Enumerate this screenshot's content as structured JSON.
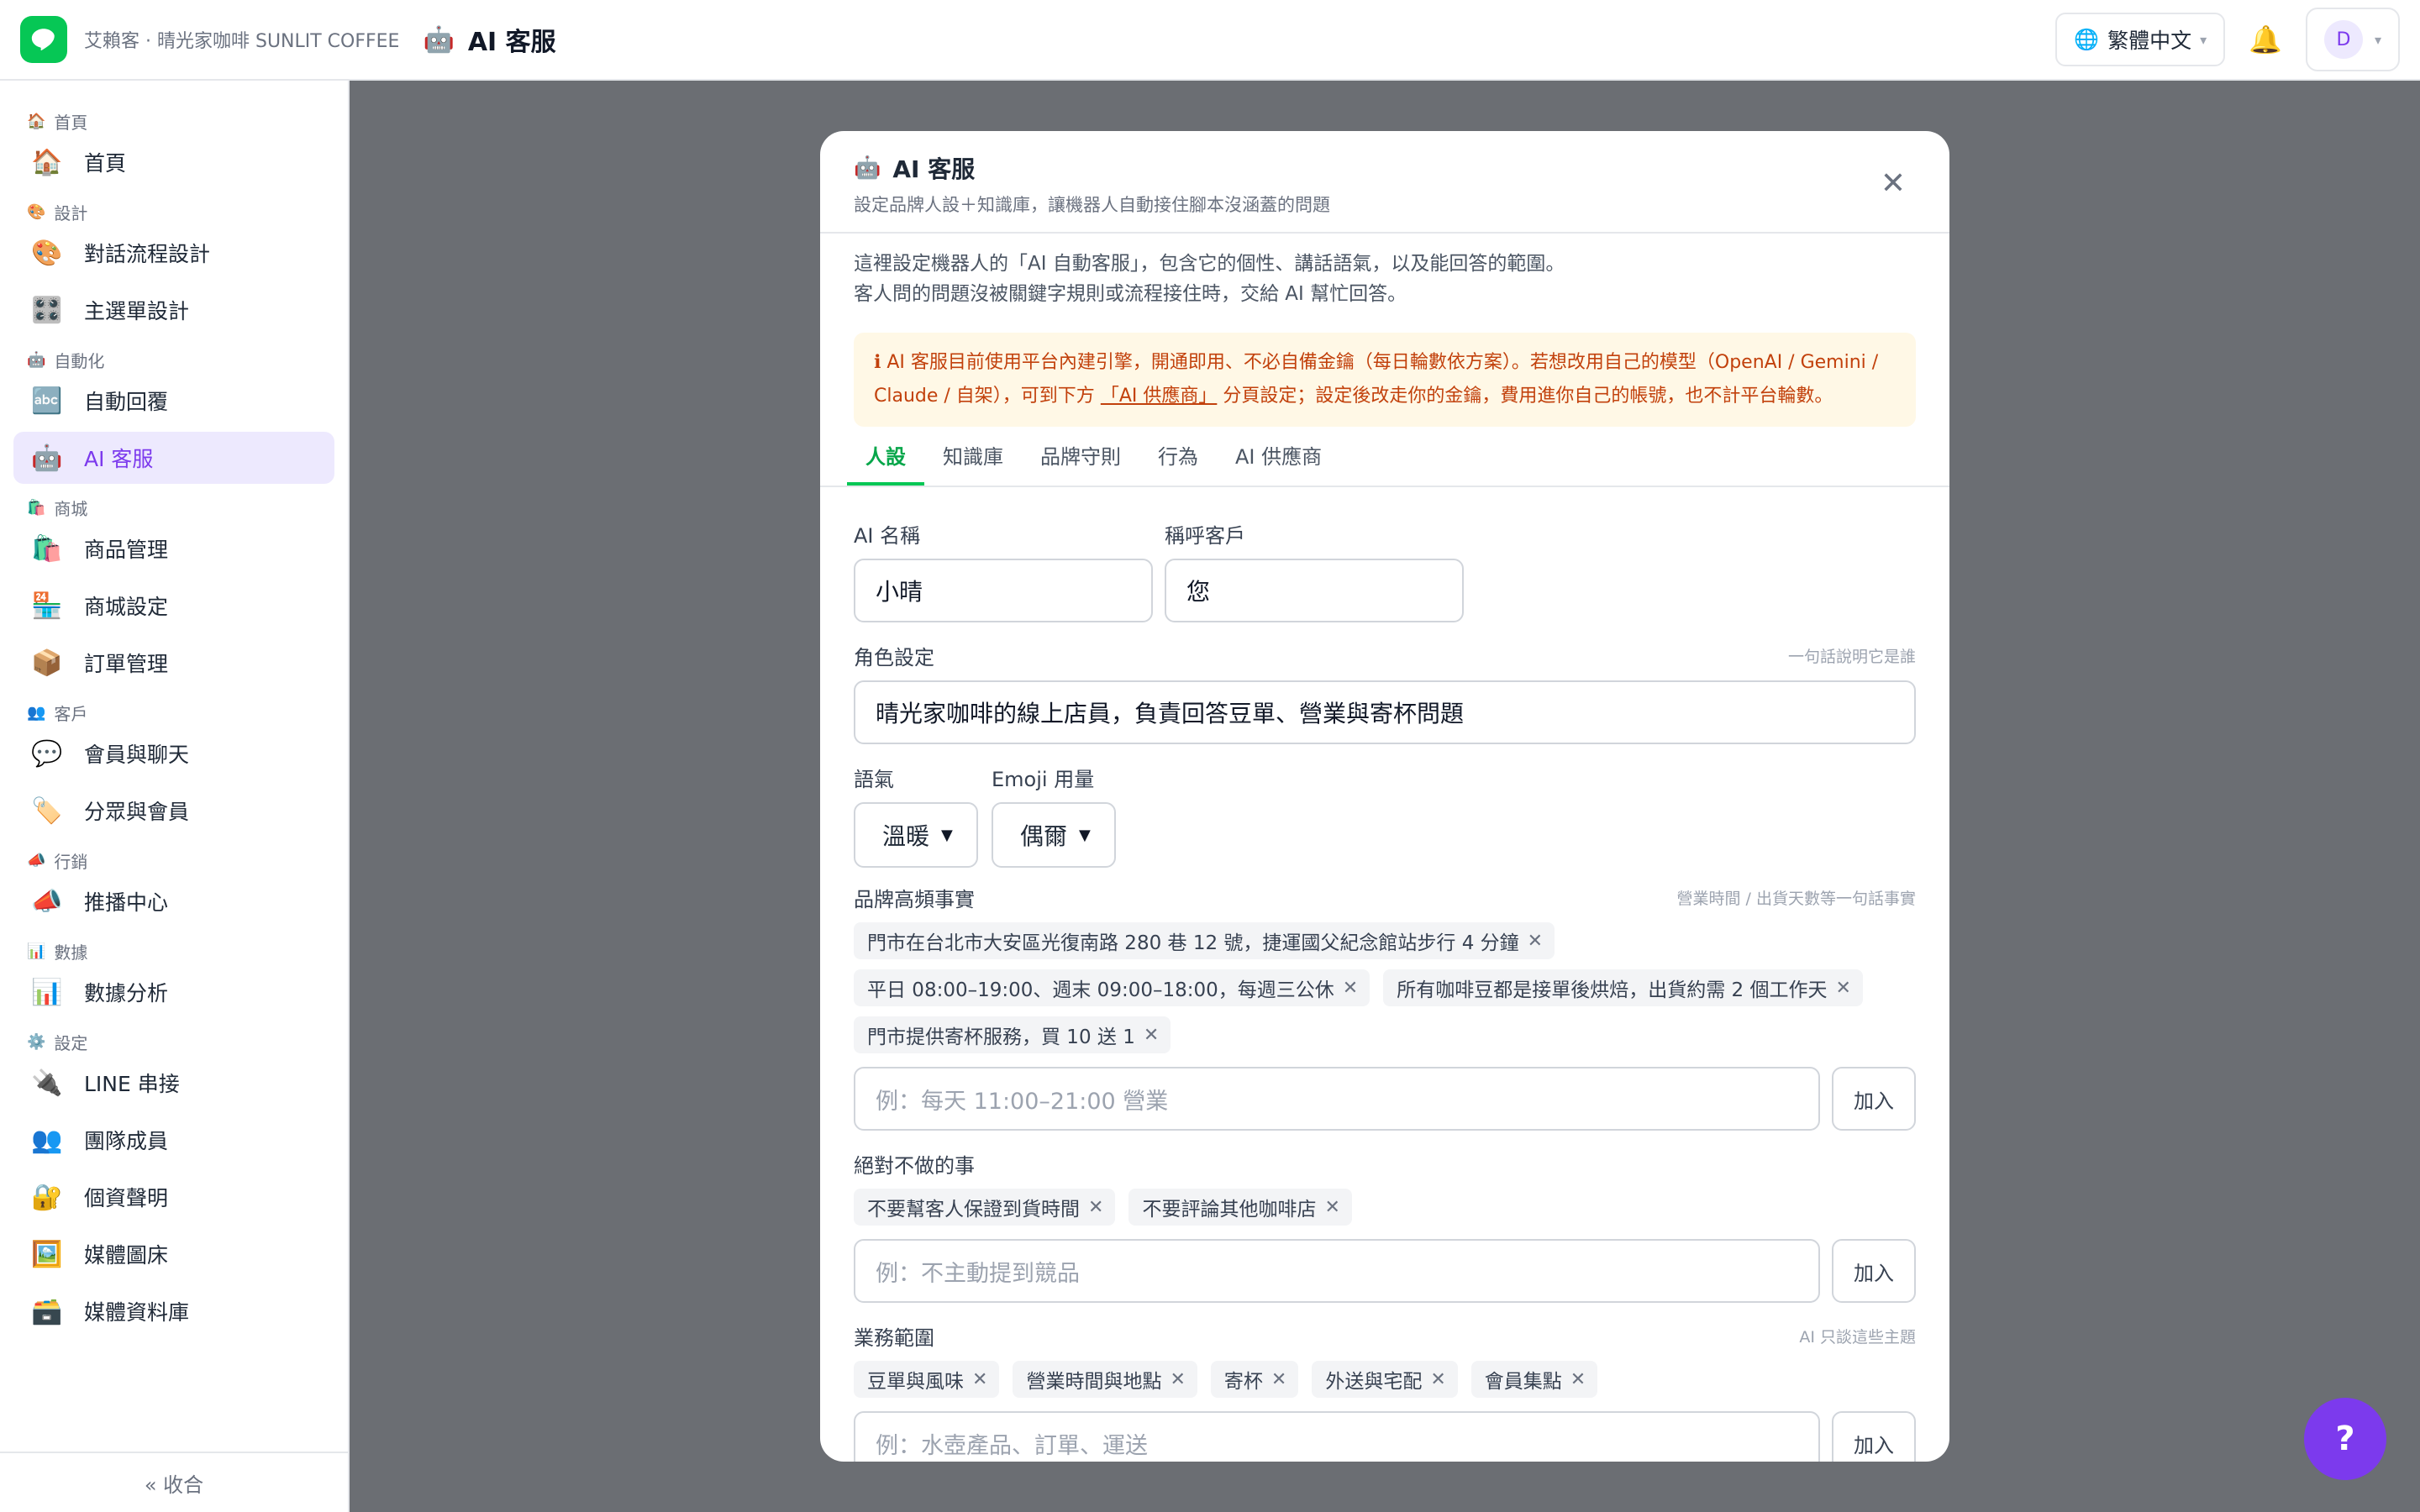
{
  "header": {
    "brand": "艾賴客 · 晴光家咖啡 SUNLIT COFFEE",
    "title_icon": "🤖",
    "title": "AI 客服",
    "language": "繁體中文",
    "avatar_initial": "D"
  },
  "sidebar": {
    "home_section": "首頁",
    "home": "首頁",
    "design_section": "設計",
    "flow_design": "對話流程設計",
    "menu_design": "主選單設計",
    "auto_section": "自動化",
    "auto_reply": "自動回覆",
    "ai_service": "AI 客服",
    "shop_section": "商城",
    "products": "商品管理",
    "shop_settings": "商城設定",
    "orders": "訂單管理",
    "customer_section": "客戶",
    "members_chat": "會員與聊天",
    "segments": "分眾與會員",
    "marketing_section": "行銷",
    "broadcast": "推播中心",
    "data_section": "數據",
    "analytics": "數據分析",
    "settings_section": "設定",
    "line": "LINE 串接",
    "team": "團隊成員",
    "privacy": "個資聲明",
    "media": "媒體圖床",
    "media_lib": "媒體資料庫",
    "collapse": "« 收合"
  },
  "modal": {
    "title": "AI 客服",
    "subtitle": "設定品牌人設＋知識庫，讓機器人自動接住腳本沒涵蓋的問題",
    "desc_1": "這裡設定機器人的「AI 自動客服」，包含它的個性、講話語氣，以及能回答的範圍。",
    "desc_2": "客人問的問題沒被關鍵字規則或流程接住時，交給 AI 幫忙回答。",
    "notice_a": "AI 客服目前使用平台內建引擎，開通即用、不必自備金鑰（每日輪數依方案）。若想改用自己的模型（OpenAI / Gemini /",
    "notice_b": "Claude / 自架），可到下方",
    "notice_link": "「AI 供應商」",
    "notice_c": "分頁設定；設定後改走你的金鑰，費用進你自己的帳號，也不計平台輪數。",
    "tabs": [
      "人設",
      "知識庫",
      "品牌守則",
      "行為",
      "AI 供應商"
    ]
  },
  "form": {
    "ai_name_label": "AI 名稱",
    "ai_name": "小晴",
    "address_label": "稱呼客戶",
    "address": "您",
    "role_label": "角色設定",
    "role_hint": "一句話說明它是誰",
    "role": "晴光家咖啡的線上店員，負責回答豆單、營業與寄杯問題",
    "tone_label": "語氣",
    "tone": "溫暖",
    "emoji_label": "Emoji 用量",
    "emoji": "偶爾",
    "facts_label": "品牌高頻事實",
    "facts_hint": "營業時間 / 出貨天數等一句話事實",
    "facts": [
      "門市在台北市大安區光復南路 280 巷 12 號，捷運國父紀念館站步行 4 分鐘",
      "平日 08:00–19:00、週末 09:00–18:00，每週三公休",
      "所有咖啡豆都是接單後烘焙，出貨約需 2 個工作天",
      "門市提供寄杯服務，買 10 送 1"
    ],
    "facts_placeholder": "例：每天 11:00–21:00 營業",
    "add": "加入",
    "never_label": "絕對不做的事",
    "never": [
      "不要幫客人保證到貨時間",
      "不要評論其他咖啡店"
    ],
    "never_placeholder": "例：不主動提到競品",
    "scope_label": "業務範圍",
    "scope_hint": "AI 只談這些主題",
    "scope": [
      "豆單與風味",
      "營業時間與地點",
      "寄杯",
      "外送與宅配",
      "會員集點"
    ],
    "scope_placeholder": "例：水壺產品、訂單、運送"
  },
  "help": "?"
}
